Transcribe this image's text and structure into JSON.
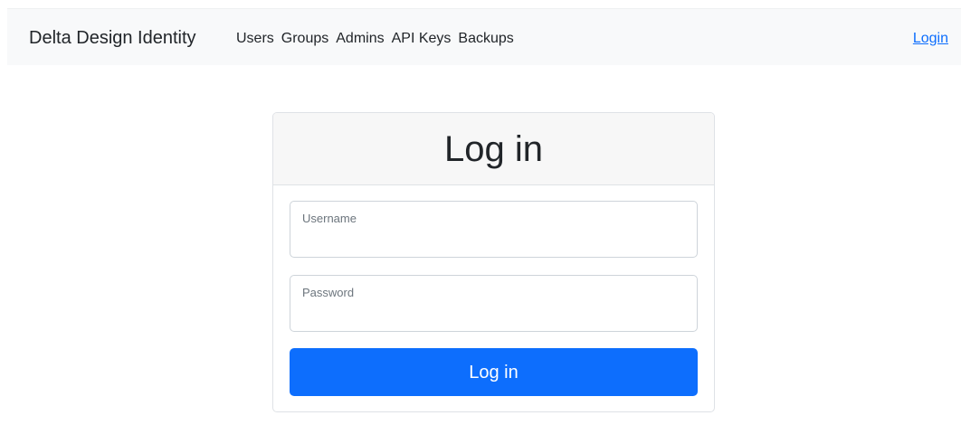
{
  "navbar": {
    "brand": "Delta Design Identity",
    "links": [
      "Users",
      "Groups",
      "Admins",
      "API Keys",
      "Backups"
    ],
    "login_link": "Login"
  },
  "login_card": {
    "title": "Log in",
    "username": {
      "label": "Username",
      "value": ""
    },
    "password": {
      "label": "Password",
      "value": ""
    },
    "submit_label": "Log in"
  },
  "colors": {
    "primary": "#0d6efd",
    "navbar_bg": "#f8f9fa",
    "card_header_bg": "#f7f7f7",
    "text": "#212529",
    "muted": "#6c757d"
  }
}
